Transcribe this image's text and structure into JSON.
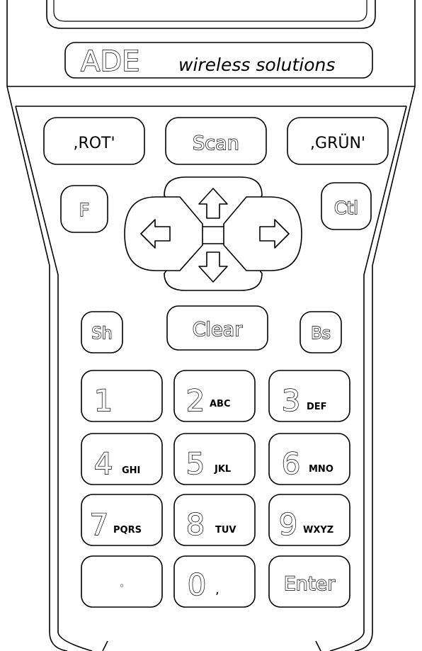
{
  "brand": {
    "logo_text": "ADE",
    "tagline": "wireless solutions"
  },
  "function_keys": {
    "red": ",ROT'",
    "scan": "Scan",
    "green": ",GRÜN'",
    "f": "F",
    "ctl": "Ctl",
    "sh": "Sh",
    "clear": "Clear",
    "bs": "Bs"
  },
  "numpad": {
    "keys": [
      {
        "digit": "1",
        "letters": ""
      },
      {
        "digit": "2",
        "letters": "ABC"
      },
      {
        "digit": "3",
        "letters": "DEF"
      },
      {
        "digit": "4",
        "letters": "GHI"
      },
      {
        "digit": "5",
        "letters": "JKL"
      },
      {
        "digit": "6",
        "letters": "MNO"
      },
      {
        "digit": "7",
        "letters": "PQRS"
      },
      {
        "digit": "8",
        "letters": "TUV"
      },
      {
        "digit": "9",
        "letters": "WXYZ"
      },
      {
        "digit": "0",
        "letters": ","
      }
    ],
    "dot": "◦",
    "enter": "Enter"
  }
}
